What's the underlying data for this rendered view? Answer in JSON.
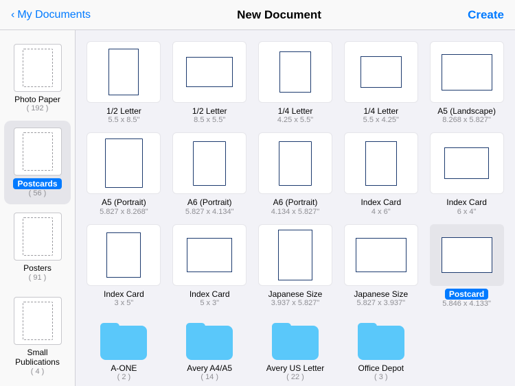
{
  "header": {
    "back_label": "My Documents",
    "title": "New Document",
    "action_label": "Create"
  },
  "sidebar": {
    "items": [
      {
        "id": "photo-paper",
        "name": "Photo Paper",
        "count": "( 192 )",
        "shape": "portrait",
        "selected": false
      },
      {
        "id": "postcards",
        "name": "Postcards",
        "count": "( 56 )",
        "shape": "portrait",
        "selected": true
      },
      {
        "id": "posters",
        "name": "Posters",
        "count": "( 91 )",
        "shape": "portrait",
        "selected": false
      },
      {
        "id": "small-publications",
        "name": "Small Publications",
        "count": "( 4 )",
        "shape": "portrait",
        "selected": false
      }
    ]
  },
  "content": {
    "items": [
      {
        "id": "half-letter-1",
        "label": "1/2 Letter",
        "sublabel": "5.5 x 8.5\"",
        "shape": "half-portrait",
        "selected": false,
        "type": "doc"
      },
      {
        "id": "half-letter-2",
        "label": "1/2 Letter",
        "sublabel": "8.5 x 5.5\"",
        "shape": "half-landscape",
        "selected": false,
        "type": "doc"
      },
      {
        "id": "quarter-letter-1",
        "label": "1/4 Letter",
        "sublabel": "4.25 x 5.5\"",
        "shape": "quarter-portrait",
        "selected": false,
        "type": "doc"
      },
      {
        "id": "quarter-letter-2",
        "label": "1/4 Letter",
        "sublabel": "5.5 x 4.25\"",
        "shape": "quarter-landscape",
        "selected": false,
        "type": "doc"
      },
      {
        "id": "a5-landscape",
        "label": "A5 (Landscape)",
        "sublabel": "8.268 x 5.827\"",
        "shape": "a5-landscape",
        "selected": false,
        "type": "doc"
      },
      {
        "id": "a5-portrait",
        "label": "A5 (Portrait)",
        "sublabel": "5.827 x 8.268\"",
        "shape": "portrait",
        "selected": false,
        "type": "doc"
      },
      {
        "id": "a6-portrait-1",
        "label": "A6 (Portrait)",
        "sublabel": "5.827 x 4.134\"",
        "shape": "portrait",
        "selected": false,
        "type": "doc"
      },
      {
        "id": "a6-portrait-2",
        "label": "A6 (Portrait)",
        "sublabel": "4.134 x 5.827\"",
        "shape": "portrait",
        "selected": false,
        "type": "doc"
      },
      {
        "id": "index-card-4x6",
        "label": "Index Card",
        "sublabel": "4 x 6\"",
        "shape": "index-portrait",
        "selected": false,
        "type": "doc"
      },
      {
        "id": "index-card-6x4",
        "label": "Index Card",
        "sublabel": "6 x 4\"",
        "shape": "index-landscape",
        "selected": false,
        "type": "doc"
      },
      {
        "id": "index-card-3x5",
        "label": "Index Card",
        "sublabel": "3 x 5\"",
        "shape": "index-3x5",
        "selected": false,
        "type": "doc"
      },
      {
        "id": "index-card-5x3",
        "label": "Index Card",
        "sublabel": "5 x 3\"",
        "shape": "index-5x3",
        "selected": false,
        "type": "doc"
      },
      {
        "id": "japanese-portrait",
        "label": "Japanese Size",
        "sublabel": "3.937 x 5.827\"",
        "shape": "japanese-portrait",
        "selected": false,
        "type": "doc"
      },
      {
        "id": "japanese-landscape",
        "label": "Japanese Size",
        "sublabel": "5.827 x 3.937\"",
        "shape": "japanese-landscape",
        "selected": false,
        "type": "doc"
      },
      {
        "id": "postcard",
        "label": "Postcard",
        "sublabel": "5.846 x 4.133\"",
        "shape": "postcard",
        "selected": true,
        "type": "doc"
      },
      {
        "id": "a-one",
        "label": "A-ONE",
        "sublabel": "( 2 )",
        "shape": "folder",
        "selected": false,
        "type": "folder"
      },
      {
        "id": "avery-a4",
        "label": "Avery A4/A5",
        "sublabel": "( 14 )",
        "shape": "folder",
        "selected": false,
        "type": "folder"
      },
      {
        "id": "avery-us",
        "label": "Avery US Letter",
        "sublabel": "( 22 )",
        "shape": "folder",
        "selected": false,
        "type": "folder"
      },
      {
        "id": "office-depot",
        "label": "Office Depot",
        "sublabel": "( 3 )",
        "shape": "folder",
        "selected": false,
        "type": "folder"
      }
    ]
  }
}
